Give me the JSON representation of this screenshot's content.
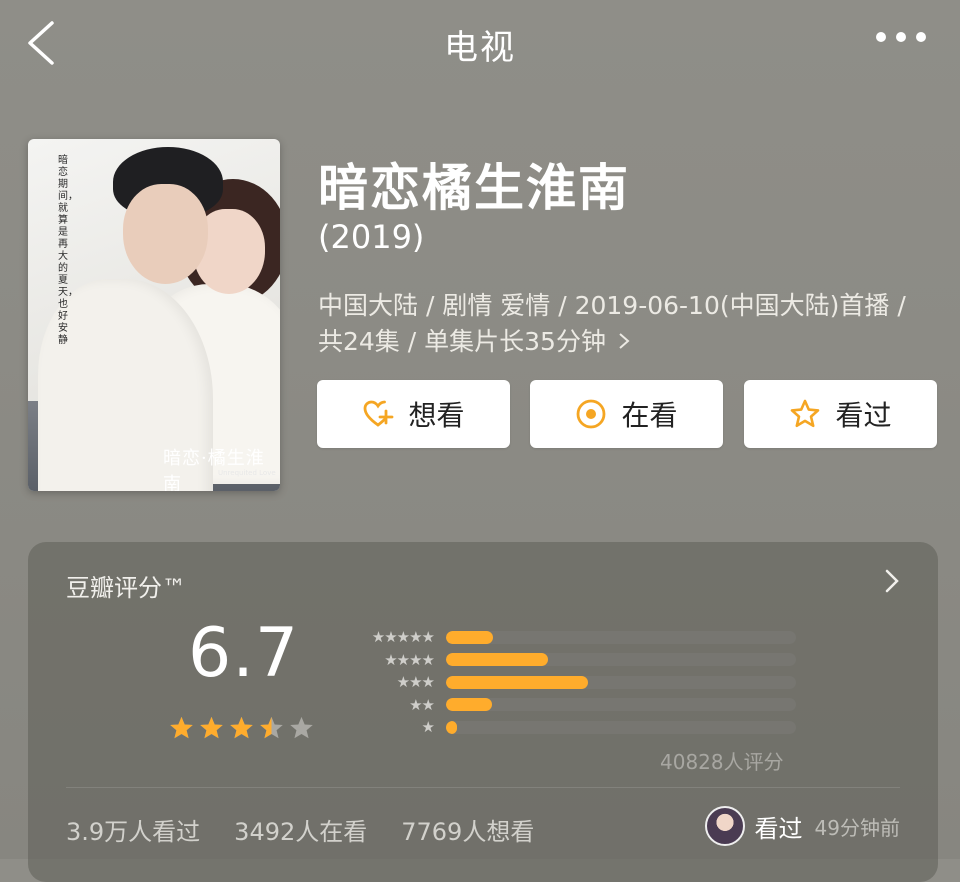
{
  "header": {
    "title": "电视",
    "back_icon": "chevron-left-icon",
    "more_icon": "more-icon"
  },
  "poster": {
    "vertical_text": "暗恋期间，就算是再大的夏天，也好安静",
    "logo": "暗恋·橘生淮南",
    "logo_sub": "Unrequited Love"
  },
  "drama": {
    "title": "暗恋橘生淮南",
    "year": "(2019)",
    "meta": "中国大陆 / 剧情 爱情 / 2019-06-10(中国大陆)首播 / 共24集 / 单集片长35分钟"
  },
  "actions": {
    "want": "想看",
    "watching": "在看",
    "watched": "看过",
    "accent": "#f5a623"
  },
  "rating": {
    "label": "豆瓣评分™",
    "score": "6.7",
    "score_stars": 3.5,
    "distribution": [
      {
        "stars": "★★★★★",
        "fraction": 0.135
      },
      {
        "stars": "★★★★",
        "fraction": 0.29
      },
      {
        "stars": "★★★",
        "fraction": 0.405
      },
      {
        "stars": "★★",
        "fraction": 0.13
      },
      {
        "stars": "★",
        "fraction": 0.03
      }
    ],
    "count": "40828人评分",
    "bar_color": "#ffac2c"
  },
  "stats": {
    "watched": "3.9万人看过",
    "watching": "3492人在看",
    "want": "7769人想看"
  },
  "recent": {
    "action": "看过",
    "time": "49分钟前"
  }
}
